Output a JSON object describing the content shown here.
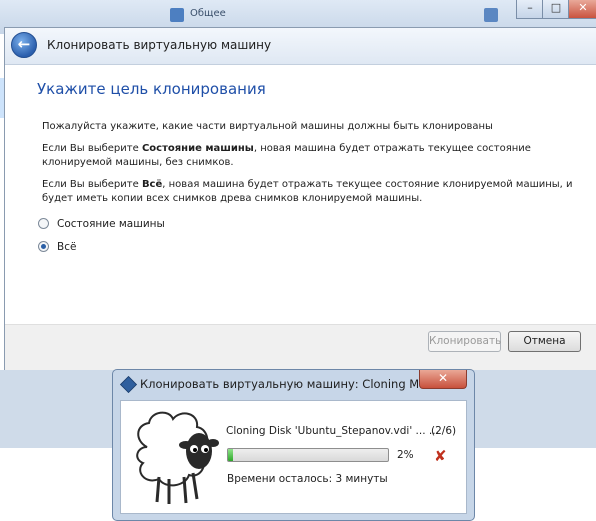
{
  "background": {
    "tab_label": "Общее"
  },
  "wizard": {
    "title": "Клонировать виртуальную машину",
    "heading": "Укажите цель клонирования",
    "intro": "Пожалуйста укажите, какие части виртуальной машины должны быть клонированы",
    "option1_desc": {
      "prefix": "Если Вы выберите ",
      "bold": "Состояние машины",
      "suffix": ", новая машина будет отражать текущее состояние клонируемой машины, без снимков."
    },
    "option2_desc": {
      "prefix": "Если Вы выберите ",
      "bold": "Всё",
      "suffix": ", новая машина будет отражать текущее состояние клонируемой машины, и будет иметь копии всех снимков древа снимков клонируемой машины."
    },
    "radio_options": [
      {
        "label": "Состояние машины",
        "selected": false
      },
      {
        "label": "Всё",
        "selected": true
      }
    ],
    "clone_button": "Клонировать",
    "cancel_button": "Отмена"
  },
  "progress_dialog": {
    "title": "Клонировать виртуальную машину: Cloning Ma...",
    "file_text": "Cloning Disk 'Ubuntu_Stepanov.vdi' ... ...",
    "step_count": "(2/6)",
    "progress_percent": 2,
    "percent_label": "2%",
    "time_left": "Времени осталось: 3 минуты"
  },
  "colors": {
    "heading": "#1f4fa8",
    "progress_fill": "#2ea82a",
    "cancel_icon": "#c0321f"
  },
  "icons": [
    "back-arrow-icon",
    "virtualbox-icon",
    "sheep-icon",
    "cancel-x-icon"
  ]
}
